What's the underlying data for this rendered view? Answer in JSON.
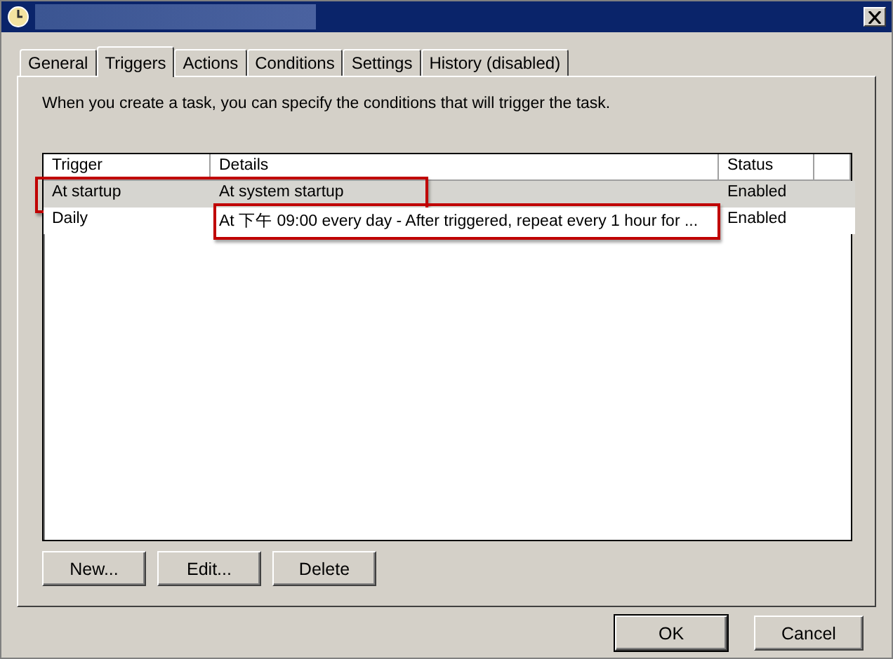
{
  "window": {
    "title_redacted": true
  },
  "tabs": [
    {
      "label": "General",
      "selected": false
    },
    {
      "label": "Triggers",
      "selected": true
    },
    {
      "label": "Actions",
      "selected": false
    },
    {
      "label": "Conditions",
      "selected": false
    },
    {
      "label": "Settings",
      "selected": false
    },
    {
      "label": "History (disabled)",
      "selected": false
    }
  ],
  "description": "When you create a task, you can specify the conditions that will trigger the task.",
  "table": {
    "columns": [
      "Trigger",
      "Details",
      "Status"
    ],
    "rows": [
      {
        "trigger": "At startup",
        "details": "At system startup",
        "status": "Enabled",
        "selected": true,
        "trigger_highlighted": true,
        "details_highlighted": true
      },
      {
        "trigger": "Daily",
        "details": "At 下午 09:00 every day - After triggered, repeat every 1 hour for ...",
        "status": "Enabled",
        "selected": false,
        "trigger_highlighted": false,
        "details_highlighted": true
      }
    ]
  },
  "list_buttons": [
    "New...",
    "Edit...",
    "Delete"
  ],
  "dialog_buttons": [
    {
      "label": "OK",
      "default": true
    },
    {
      "label": "Cancel",
      "default": false
    }
  ]
}
